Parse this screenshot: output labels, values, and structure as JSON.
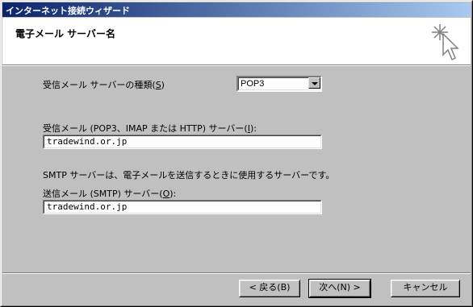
{
  "window": {
    "title": "インターネット接続ウィザード"
  },
  "header": {
    "title": "電子メール サーバー名",
    "icon": "wizard-sparkle-cursor-icon"
  },
  "form": {
    "server_type_label_pre": "受信メール サーバーの種類(",
    "server_type_label_key": "S",
    "server_type_label_post": ")",
    "server_type_value": "POP3",
    "incoming_label_pre": "受信メール (POP3、IMAP または HTTP) サーバー(",
    "incoming_label_key": "I",
    "incoming_label_post": "):",
    "incoming_value": "tradewind.or.jp",
    "smtp_note": "SMTP サーバーは、電子メールを送信するときに使用するサーバーです。",
    "outgoing_label_pre": "送信メール (SMTP) サーバー(",
    "outgoing_label_key": "O",
    "outgoing_label_post": "):",
    "outgoing_value": "tradewind.or.jp"
  },
  "buttons": {
    "back": "< 戻る(B)",
    "next": "次へ(N) >",
    "cancel": "キャンセル"
  }
}
